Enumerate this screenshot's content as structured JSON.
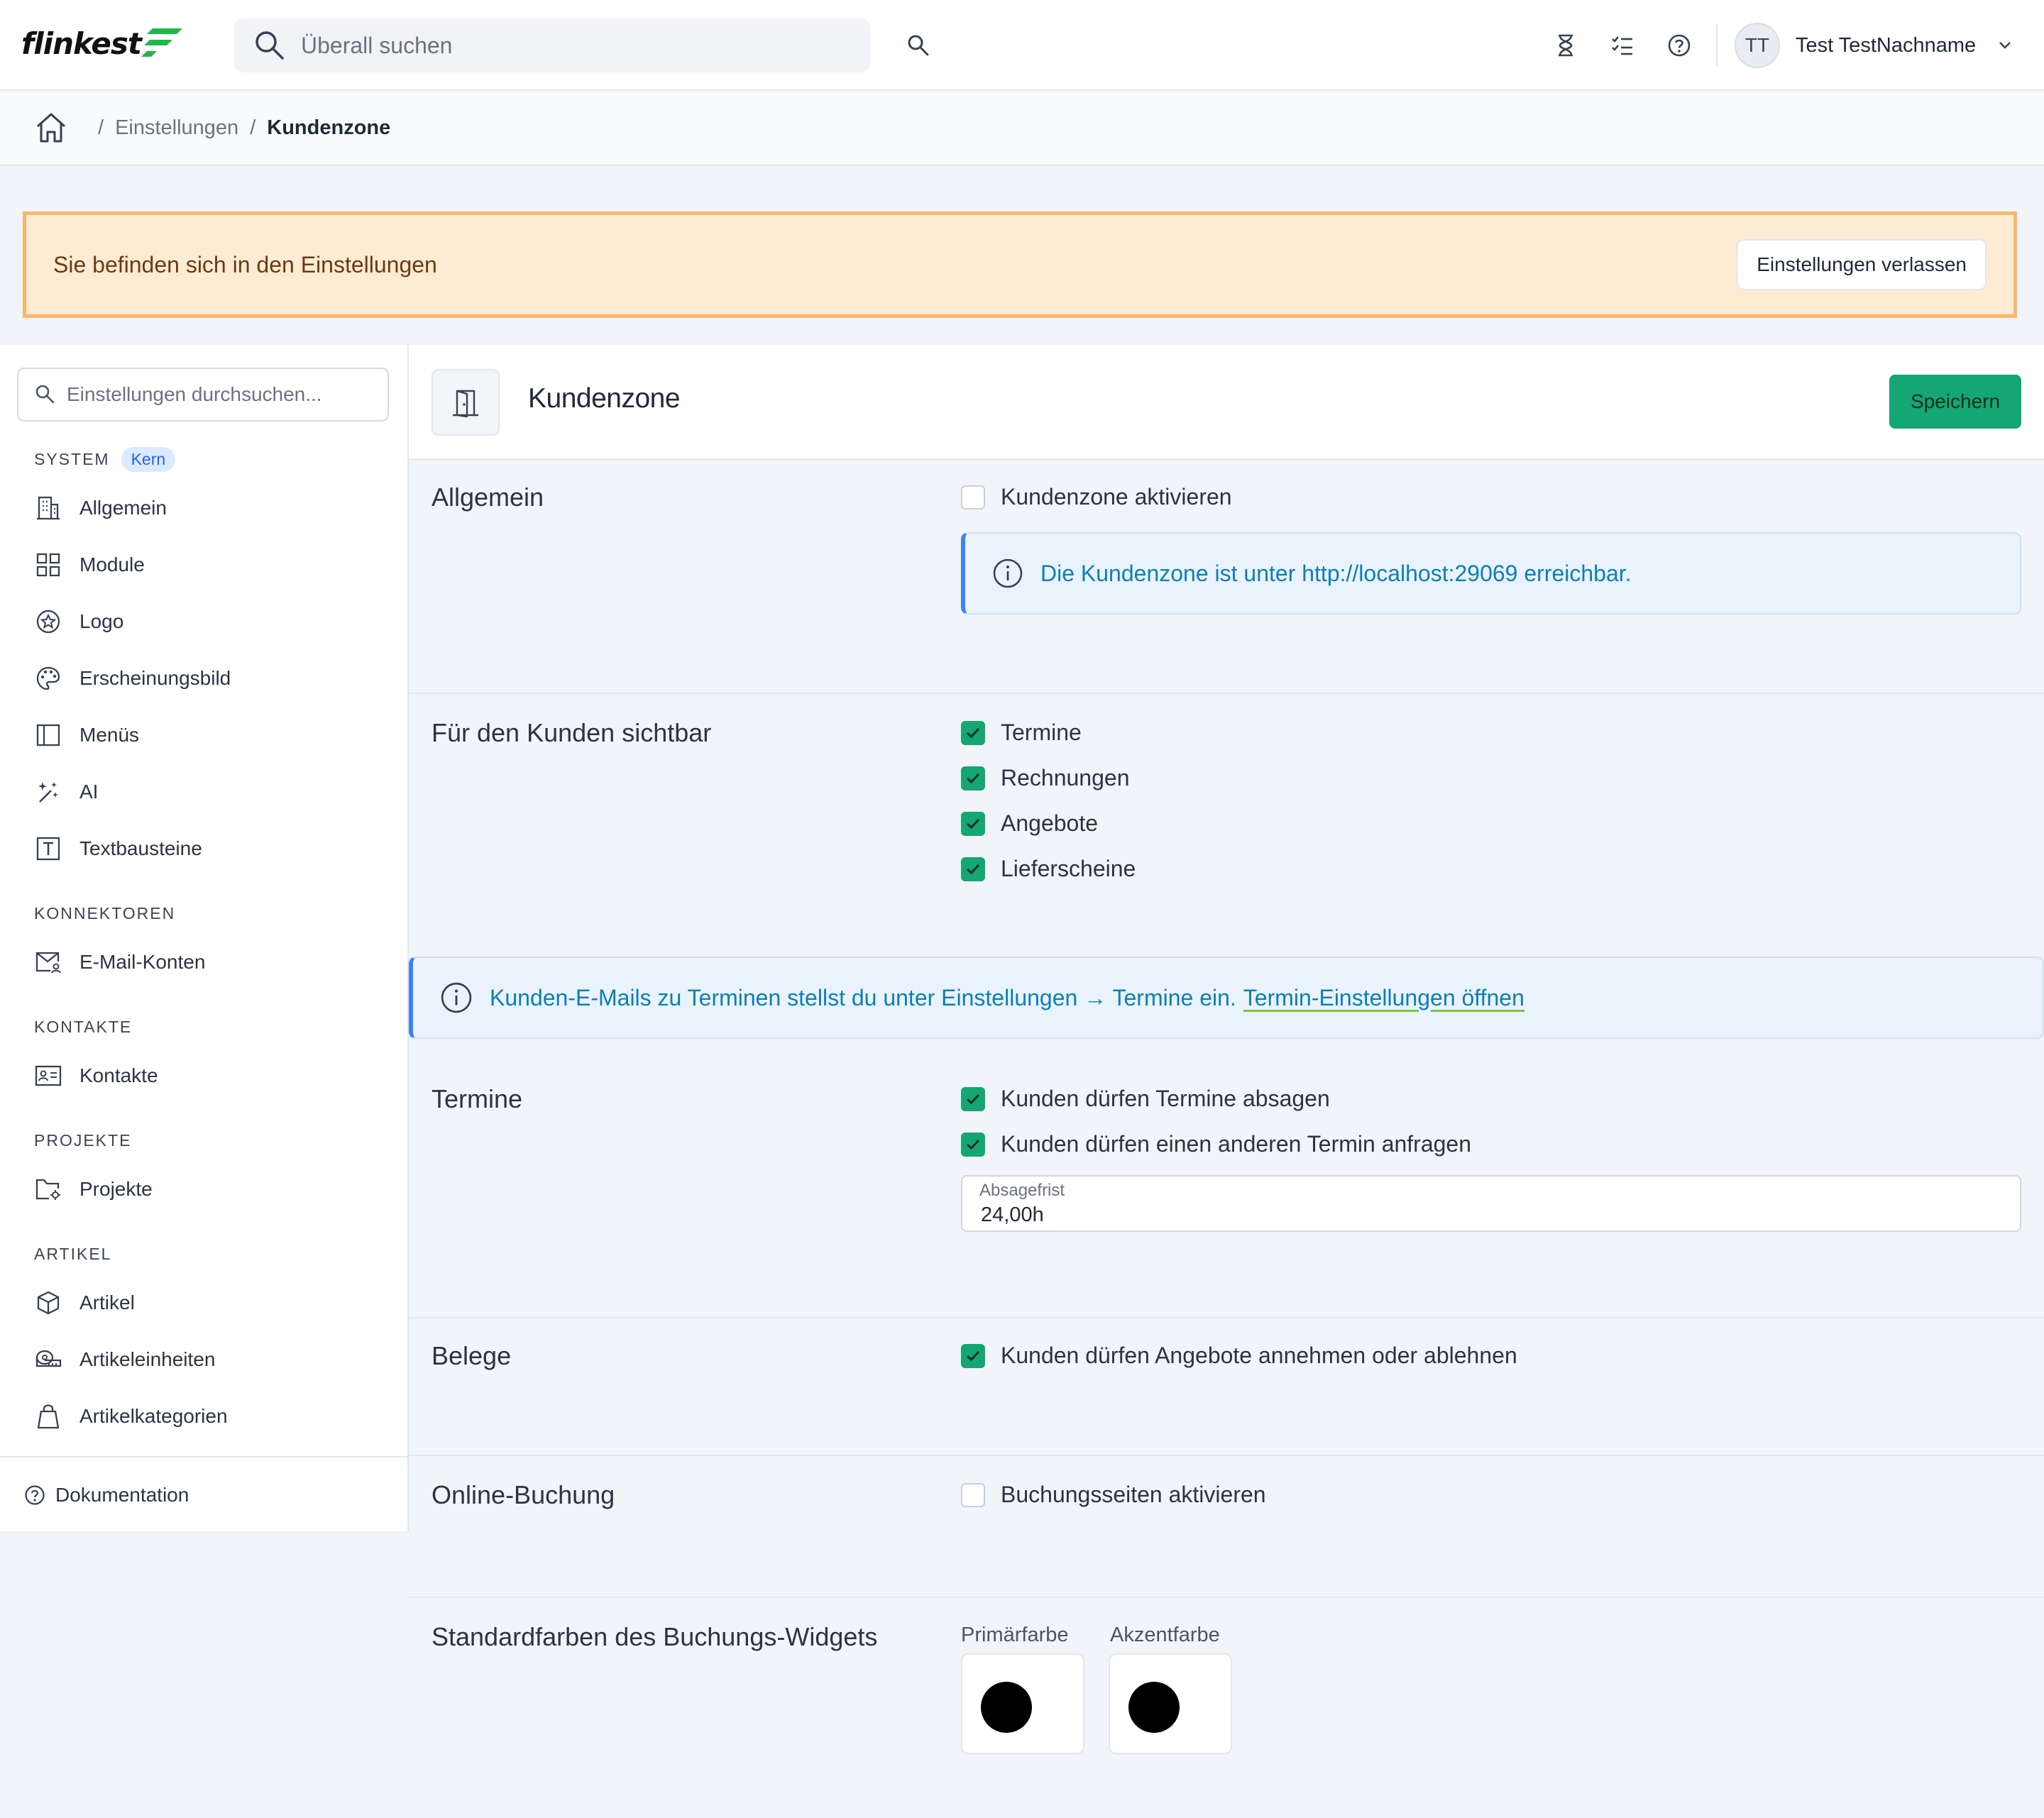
{
  "app": {
    "logo_text": "flinkest"
  },
  "topbar": {
    "search_placeholder": "Überall suchen",
    "user_initials": "TT",
    "user_name": "Test TestNachname"
  },
  "breadcrumb": {
    "items": [
      "Einstellungen",
      "Kundenzone"
    ]
  },
  "notice": {
    "text": "Sie befinden sich in den Einstellungen",
    "button": "Einstellungen verlassen"
  },
  "sidebar": {
    "search_placeholder": "Einstellungen durchsuchen...",
    "sections": [
      {
        "title": "SYSTEM",
        "badge": "Kern",
        "items": [
          "Allgemein",
          "Module",
          "Logo",
          "Erscheinungsbild",
          "Menüs",
          "AI",
          "Textbausteine"
        ]
      },
      {
        "title": "KONNEKTOREN",
        "items": [
          "E-Mail-Konten"
        ]
      },
      {
        "title": "KONTAKTE",
        "items": [
          "Kontakte"
        ]
      },
      {
        "title": "PROJEKTE",
        "items": [
          "Projekte"
        ]
      },
      {
        "title": "ARTIKEL",
        "items": [
          "Artikel",
          "Artikeleinheiten",
          "Artikelkategorien"
        ]
      }
    ],
    "footer": "Dokumentation"
  },
  "page": {
    "title": "Kundenzone",
    "save_button": "Speichern"
  },
  "sections": {
    "allgemein": {
      "title": "Allgemein",
      "checkbox": {
        "label": "Kundenzone aktivieren",
        "checked": false
      },
      "info": "Die Kundenzone ist unter http://localhost:29069 erreichbar."
    },
    "sichtbar": {
      "title": "Für den Kunden sichtbar",
      "checkboxes": [
        {
          "label": "Termine",
          "checked": true
        },
        {
          "label": "Rechnungen",
          "checked": true
        },
        {
          "label": "Angebote",
          "checked": true
        },
        {
          "label": "Lieferscheine",
          "checked": true
        }
      ]
    },
    "mail_info": {
      "text": "Kunden-E-Mails zu Terminen stellst du unter Einstellungen → Termine ein.",
      "link": "Termin-Einstellungen öffnen"
    },
    "termine": {
      "title": "Termine",
      "checkboxes": [
        {
          "label": "Kunden dürfen Termine absagen",
          "checked": true
        },
        {
          "label": "Kunden dürfen einen anderen Termin anfragen",
          "checked": true
        }
      ],
      "field_label": "Absagefrist",
      "field_value": "24,00h"
    },
    "belege": {
      "title": "Belege",
      "checkbox": {
        "label": "Kunden dürfen Angebote annehmen oder ablehnen",
        "checked": true
      }
    },
    "online": {
      "title": "Online-Buchung",
      "checkbox": {
        "label": "Buchungsseiten aktivieren",
        "checked": false
      }
    },
    "farben": {
      "title": "Standardfarben des Buchungs-Widgets",
      "primary_label": "Primärfarbe",
      "primary_color": "#000000",
      "accent_label": "Akzentfarbe",
      "accent_color": "#000000"
    }
  },
  "colors": {
    "brand_green": "#14a675",
    "info_blue": "#0b7fb8",
    "notice_bg": "#fdecd3",
    "notice_border": "#f9b76a"
  }
}
